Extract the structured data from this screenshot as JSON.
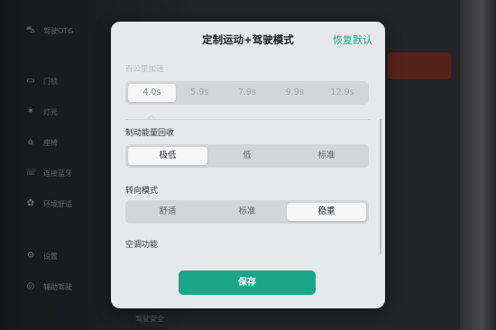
{
  "background": {
    "menu_items": [
      {
        "icon": "car-icon",
        "label": "驾驶OTG"
      },
      {
        "icon": "door-icon",
        "label": "门锁"
      },
      {
        "icon": "light-icon",
        "label": "灯光"
      },
      {
        "icon": "seat-icon",
        "label": "座椅"
      },
      {
        "icon": "phone-icon",
        "label": "连接蓝牙"
      },
      {
        "icon": "ambient-icon",
        "label": "环境舒适"
      },
      {
        "icon": "settings-icon",
        "label": "设置"
      },
      {
        "icon": "assist-icon",
        "label": "辅助驾驶"
      }
    ],
    "bottom_text": "驾驶安全"
  },
  "modal": {
    "title": "定制运动+驾驶模式",
    "reset_label": "恢复默认",
    "acceleration": {
      "label": "百公里加速",
      "options": [
        "4.0s",
        "5.9s",
        "7.9s",
        "9.9s",
        "12.9s"
      ],
      "selected": "4.0s"
    },
    "regen": {
      "label": "制动能量回收",
      "options": [
        "极低",
        "低",
        "标准"
      ],
      "selected": "极低"
    },
    "steering": {
      "label": "转向模式",
      "options": [
        "舒适",
        "标准",
        "稳重"
      ],
      "selected": "稳重"
    },
    "ac_label": "空调功能",
    "save_label": "保存"
  },
  "colors": {
    "accent": "#1aa789",
    "modal_bg": "#e7e8ea"
  }
}
